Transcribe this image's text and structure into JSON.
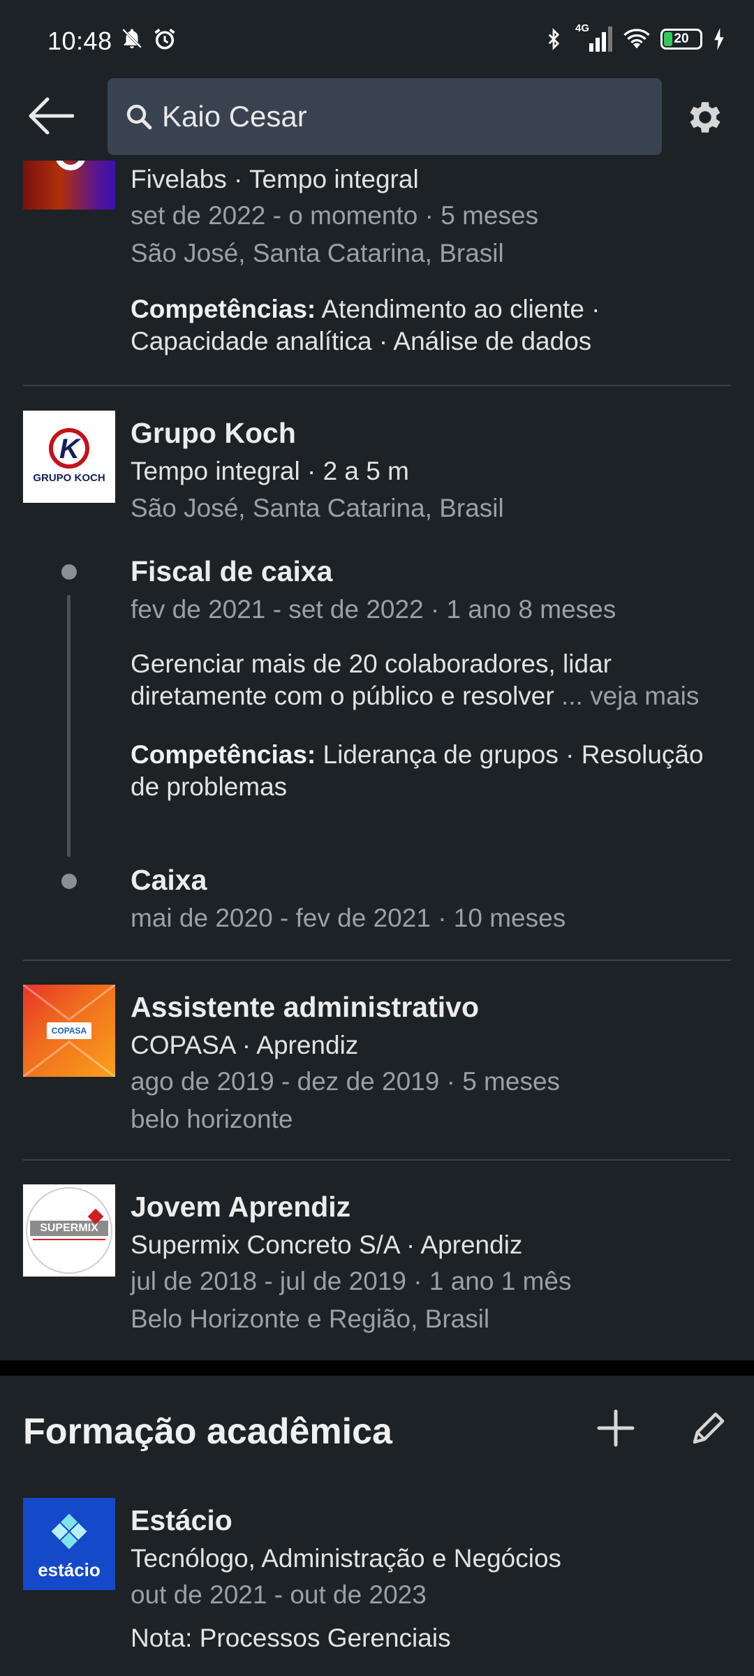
{
  "status": {
    "time": "10:48",
    "battery": "20",
    "network": "4G"
  },
  "search": {
    "query": "Kaio Cesar"
  },
  "experience": [
    {
      "company_line": "Fivelabs · Tempo integral",
      "dates": "set de 2022 - o momento · 5 meses",
      "location": "São José, Santa Catarina, Brasil",
      "skills_label": "Competências:",
      "skills": "Atendimento ao cliente · Capacidade analítica · Análise de dados"
    },
    {
      "company": "Grupo Koch",
      "logo_text": "GRUPO KOCH",
      "employment": "Tempo integral · 2 a 5 m",
      "location": "São José, Santa Catarina, Brasil",
      "roles": [
        {
          "title": "Fiscal de caixa",
          "dates": "fev de 2021 - set de 2022 · 1 ano 8 meses",
          "description": "Gerenciar mais de 20 colaboradores, lidar diretamente com o público e resolver",
          "see_more": "... veja mais",
          "skills_label": "Competências:",
          "skills": "Liderança de grupos · Resolução de problemas"
        },
        {
          "title": "Caixa",
          "dates": "mai de 2020 - fev de 2021 · 10 meses"
        }
      ]
    },
    {
      "title": "Assistente administrativo",
      "logo_text": "COPASA",
      "company_line": "COPASA · Aprendiz",
      "dates": "ago de 2019 - dez de 2019 · 5 meses",
      "location": "belo horizonte"
    },
    {
      "title": "Jovem Aprendiz",
      "logo_text": "SUPERMIX",
      "company_line": "Supermix Concreto S/A · Aprendiz",
      "dates": "jul de 2018 - jul de 2019 · 1 ano 1 mês",
      "location": "Belo Horizonte e Região, Brasil"
    }
  ],
  "education_section": {
    "title": "Formação acadêmica",
    "items": [
      {
        "school": "Estácio",
        "logo_text": "estácio",
        "degree": "Tecnólogo, Administração e Negócios",
        "dates": "out de 2021 - out de 2023",
        "grade": "Nota: Processos Gerenciais"
      }
    ]
  },
  "colors": {
    "background": "#1d2226",
    "search_bg": "#38434f",
    "muted_text": "#9aa0a6",
    "divider": "#3b4248"
  }
}
